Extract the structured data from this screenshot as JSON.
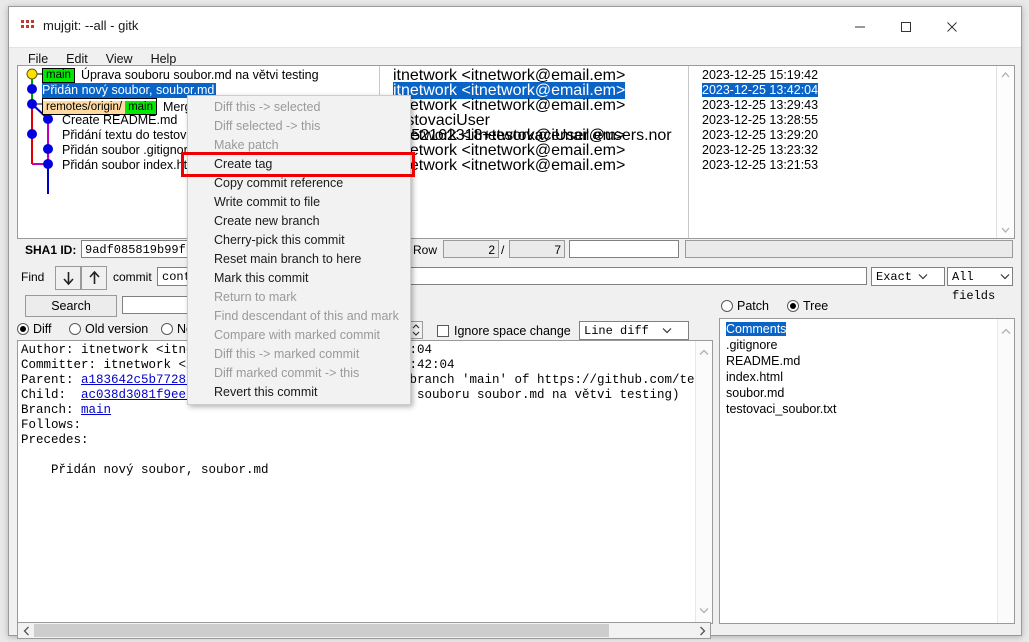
{
  "window": {
    "title": "mujgit: --all - gitk",
    "icon": "gitk-icon",
    "minimize": "—",
    "maximize": "☐",
    "close": "✕"
  },
  "menubar": {
    "items": [
      "File",
      "Edit",
      "View",
      "Help"
    ]
  },
  "commits": [
    {
      "message": "Úprava souboru soubor.md na větvi testing",
      "author": "itnetwork <itnetwork@email.em>",
      "date": "2023-12-25 15:19:42",
      "selected": false,
      "refs": [
        {
          "label": "main",
          "style": "green"
        }
      ]
    },
    {
      "message": "Přidán nový soubor, soubor.md",
      "author": "itnetwork <itnetwork@email.em>",
      "date": "2023-12-25 13:42:04",
      "selected": true,
      "refs": []
    },
    {
      "message": "Merge branch 'main' of https://github.com/testov",
      "author": "itnetwork <itnetwork@email.em>",
      "date": "2023-12-25 13:29:43",
      "selected": false,
      "refs": [
        {
          "label_a": "remotes/origin/",
          "label_b": "main",
          "style": "split"
        }
      ]
    },
    {
      "message": "Create README.md",
      "author": "testovaciUser <152162318+testovaciUser@users.nor",
      "date": "2023-12-25 13:28:55",
      "selected": false,
      "refs": []
    },
    {
      "message": "Přidání textu do testovaciho souboru",
      "author": "itnetwork <itnetwork@email.em>",
      "date": "2023-12-25 13:29:20",
      "selected": false,
      "refs": []
    },
    {
      "message": "Přidán soubor .gitignore",
      "author": "itnetwork <itnetwork@email.em>",
      "date": "2023-12-25 13:23:32",
      "selected": false,
      "refs": []
    },
    {
      "message": "Přidán soubor index.html",
      "author": "itnetwork <itnetwork@email.em>",
      "date": "2023-12-25 13:21:53",
      "selected": false,
      "refs": []
    }
  ],
  "sha_row": {
    "label": "SHA1 ID:",
    "value": "9adf085819b99fb",
    "row_label": "Row",
    "row_current": "2",
    "row_sep": "/",
    "row_total": "7"
  },
  "find_row": {
    "label": "Find",
    "down_icon": "arrow-down-icon",
    "up_icon": "arrow-up-icon",
    "commit_label": "commit",
    "containing_value": "conta",
    "find_text": "",
    "exact_value": "Exact",
    "fields_value": "All fields"
  },
  "search_row": {
    "search_button": "Search",
    "search_value": "",
    "diff_label": "Diff",
    "old_version_label": "Old version",
    "new_version_label": "Ne",
    "lines_spinner": "",
    "ignore_space_label": "Ignore space change",
    "diff_mode_value": "Line diff",
    "patch_label": "Patch",
    "tree_label": "Tree"
  },
  "detail": {
    "lines": [
      {
        "prefix": "Author: ",
        "value": "itnetwork <itnet",
        "link": false
      },
      {
        "prefix": "Committer: ",
        "value": "itnetwork <it",
        "link": false
      },
      {
        "prefix": "Parent: ",
        "value": "a183642c5b772850",
        "link": true
      },
      {
        "prefix": "Child:  ",
        "value": "ac038d3081f9ee5a",
        "link": true
      },
      {
        "prefix": "Branch: ",
        "value": "main",
        "link": true
      },
      {
        "prefix": "Follows:",
        "value": "",
        "link": false
      },
      {
        "prefix": "Precedes:",
        "value": "",
        "link": false
      },
      {
        "prefix": "",
        "value": "",
        "link": false
      },
      {
        "prefix": "    Přidán nový soubor, soubor.md",
        "value": "",
        "link": false
      }
    ],
    "right_fragments": [
      "2:04",
      "3:42:04",
      " branch 'main' of https://github.com/testov",
      "a souboru soubor.md na větvi testing)"
    ]
  },
  "tree": {
    "items": [
      {
        "label": "Comments",
        "selected": true
      },
      {
        "label": ".gitignore",
        "selected": false
      },
      {
        "label": "README.md",
        "selected": false
      },
      {
        "label": "index.html",
        "selected": false
      },
      {
        "label": "soubor.md",
        "selected": false
      },
      {
        "label": "testovaci_soubor.txt",
        "selected": false
      }
    ]
  },
  "context_menu": {
    "items": [
      {
        "label": "Diff this -> selected",
        "enabled": false,
        "highlighted": false
      },
      {
        "label": "Diff selected -> this",
        "enabled": false,
        "highlighted": false
      },
      {
        "label": "Make patch",
        "enabled": false,
        "highlighted": false
      },
      {
        "label": "Create tag",
        "enabled": true,
        "highlighted": true
      },
      {
        "label": "Copy commit reference",
        "enabled": true,
        "highlighted": false
      },
      {
        "label": "Write commit to file",
        "enabled": true,
        "highlighted": false
      },
      {
        "label": "Create new branch",
        "enabled": true,
        "highlighted": false
      },
      {
        "label": "Cherry-pick this commit",
        "enabled": true,
        "highlighted": false
      },
      {
        "label": "Reset main branch to here",
        "enabled": true,
        "highlighted": false
      },
      {
        "label": "Mark this commit",
        "enabled": true,
        "highlighted": false
      },
      {
        "label": "Return to mark",
        "enabled": false,
        "highlighted": false
      },
      {
        "label": "Find descendant of this and mark",
        "enabled": false,
        "highlighted": false
      },
      {
        "label": "Compare with marked commit",
        "enabled": false,
        "highlighted": false
      },
      {
        "label": "Diff this -> marked commit",
        "enabled": false,
        "highlighted": false
      },
      {
        "label": "Diff marked commit -> this",
        "enabled": false,
        "highlighted": false
      },
      {
        "label": "Revert this commit",
        "enabled": true,
        "highlighted": false
      }
    ]
  },
  "colors": {
    "selection": "#0a64c8",
    "ref_green": "#00ea00",
    "ref_orange": "#ffd9a0",
    "highlight_red": "#ee0000",
    "link": "#0000cc"
  }
}
